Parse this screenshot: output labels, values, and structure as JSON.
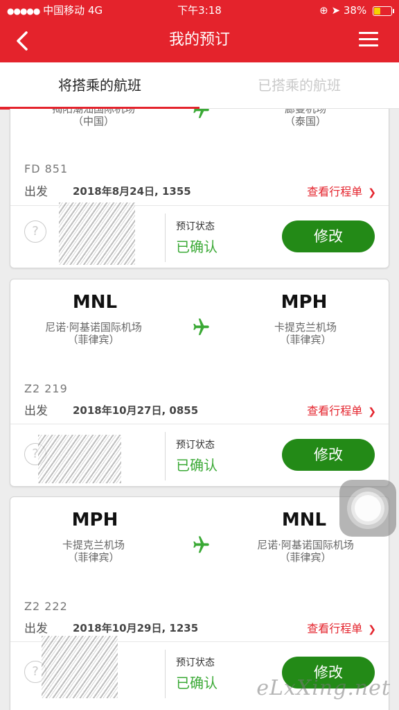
{
  "status_bar": {
    "carrier": "中国移动",
    "network": "4G",
    "time": "下午3:18",
    "battery": "38%"
  },
  "nav": {
    "title": "我的预订"
  },
  "tabs": [
    {
      "label": "将搭乘的航班"
    },
    {
      "label": "已搭乘的航班"
    }
  ],
  "flights": [
    {
      "origin": {
        "airport": "揭阳潮汕国际机场",
        "country": "（中国）"
      },
      "destination": {
        "airport": "廊曼机场",
        "country": "（泰国）"
      },
      "flight_no": "FD  851",
      "depart_label": "出发",
      "depart_datetime": "2018年8月24日, 1355",
      "itinerary_link": "查看行程单",
      "booking_status_label": "预订状态",
      "booking_status": "已确认",
      "edit_label": "修改"
    },
    {
      "origin": {
        "code": "MNL",
        "airport": "尼诺·阿基诺国际机场",
        "country": "（菲律宾）"
      },
      "destination": {
        "code": "MPH",
        "airport": "卡提克兰机场",
        "country": "（菲律宾）"
      },
      "flight_no": "Z2  219",
      "depart_label": "出发",
      "depart_datetime": "2018年10月27日, 0855",
      "itinerary_link": "查看行程单",
      "booking_status_label": "预订状态",
      "booking_status": "已确认",
      "edit_label": "修改"
    },
    {
      "origin": {
        "code": "MPH",
        "airport": "卡提克兰机场",
        "country": "（菲律宾）"
      },
      "destination": {
        "code": "MNL",
        "airport": "尼诺·阿基诺国际机场",
        "country": "（菲律宾）"
      },
      "flight_no": "Z2  222",
      "depart_label": "出发",
      "depart_datetime": "2018年10月29日, 1235",
      "itinerary_link": "查看行程单",
      "booking_status_label": "预订状态",
      "booking_status": "已确认",
      "edit_label": "修改"
    }
  ],
  "help_icon_glyph": "?",
  "watermark": "eLxXing.net",
  "colors": {
    "brand_red": "#e4232c",
    "confirm_green": "#3aa935",
    "button_green": "#238a17",
    "plane_green": "#3aa935"
  }
}
